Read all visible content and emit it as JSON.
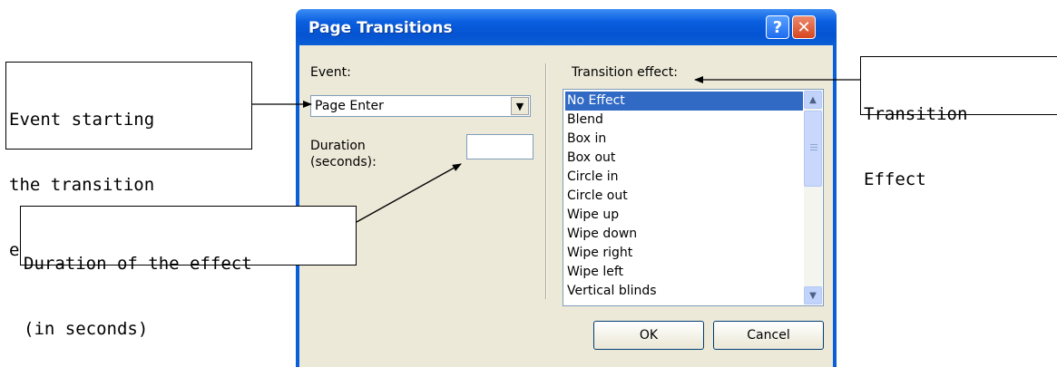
{
  "dialog": {
    "title": "Page Transitions",
    "help_icon": "?",
    "close_icon": "✕",
    "event_label": "Event:",
    "event_value": "Page Enter",
    "duration_label_line1": "Duration",
    "duration_label_line2": "(seconds):",
    "duration_value": "",
    "transition_label": "Transition effect:",
    "effects": [
      "No Effect",
      "Blend",
      "Box in",
      "Box out",
      "Circle in",
      "Circle out",
      "Wipe up",
      "Wipe down",
      "Wipe right",
      "Wipe left",
      "Vertical blinds"
    ],
    "selected_effect": "No Effect",
    "ok_label": "OK",
    "cancel_label": "Cancel",
    "scroll_up_icon": "▲",
    "scroll_down_icon": "▼",
    "dropdown_icon": "▼"
  },
  "annotations": {
    "event": [
      "Event starting",
      "the transition",
      "effect"
    ],
    "transition": [
      "Transition",
      "Effect"
    ],
    "duration": [
      "Duration of the effect",
      "(in seconds)"
    ]
  },
  "colors": {
    "titlebar": "#0a5ed6",
    "selection": "#316ac5",
    "dialog_face": "#ece9d8"
  }
}
